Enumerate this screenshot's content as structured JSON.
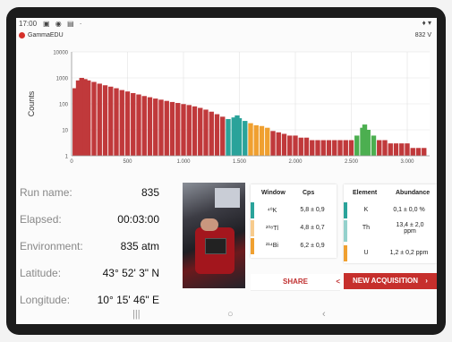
{
  "status_bar": {
    "time": "17:00",
    "icons": "▣ ◉ ▤ ·",
    "right": "♦ ▾"
  },
  "app_bar": {
    "name": "GammaEDU",
    "battery": "832 V"
  },
  "colors": {
    "accent": "#c62f2c",
    "k_band": "#2aa39a",
    "th_band": "#f0a030",
    "u_band": "#4caf50",
    "counts": "#c0393b"
  },
  "chart_data": {
    "type": "bar",
    "ylabel": "Counts",
    "xlabel": "",
    "y_scale": "log",
    "ylim": [
      1,
      10000
    ],
    "y_ticks": [
      "10000",
      "1000",
      "100",
      "10",
      "1"
    ],
    "x_ticks": [
      "0",
      "500",
      "1.000",
      "1.500",
      "2.000",
      "2.500",
      "3.000"
    ],
    "xlim": [
      0,
      3200
    ],
    "highlight_bands": [
      {
        "name": "K",
        "from": 1370,
        "to": 1570,
        "color": "#2aa39a"
      },
      {
        "name": "Th",
        "from": 1580,
        "to": 1750,
        "color": "#f0a030"
      },
      {
        "name": "U",
        "from": 2540,
        "to": 2720,
        "color": "#4caf50"
      }
    ],
    "spectrum": [
      [
        30,
        400
      ],
      [
        60,
        800
      ],
      [
        90,
        1000
      ],
      [
        120,
        900
      ],
      [
        150,
        800
      ],
      [
        200,
        700
      ],
      [
        250,
        600
      ],
      [
        300,
        520
      ],
      [
        350,
        460
      ],
      [
        400,
        400
      ],
      [
        450,
        340
      ],
      [
        500,
        300
      ],
      [
        550,
        260
      ],
      [
        600,
        230
      ],
      [
        650,
        200
      ],
      [
        700,
        180
      ],
      [
        750,
        160
      ],
      [
        800,
        145
      ],
      [
        850,
        130
      ],
      [
        900,
        118
      ],
      [
        950,
        108
      ],
      [
        1000,
        98
      ],
      [
        1050,
        90
      ],
      [
        1100,
        80
      ],
      [
        1150,
        70
      ],
      [
        1200,
        60
      ],
      [
        1250,
        50
      ],
      [
        1300,
        40
      ],
      [
        1350,
        32
      ],
      [
        1400,
        26
      ],
      [
        1450,
        30
      ],
      [
        1480,
        36
      ],
      [
        1500,
        28
      ],
      [
        1550,
        22
      ],
      [
        1600,
        18
      ],
      [
        1650,
        15
      ],
      [
        1700,
        14
      ],
      [
        1750,
        12
      ],
      [
        1800,
        9
      ],
      [
        1850,
        8
      ],
      [
        1900,
        7
      ],
      [
        1950,
        6
      ],
      [
        2000,
        6
      ],
      [
        2050,
        5
      ],
      [
        2100,
        5
      ],
      [
        2150,
        4
      ],
      [
        2200,
        4
      ],
      [
        2250,
        4
      ],
      [
        2300,
        4
      ],
      [
        2350,
        4
      ],
      [
        2400,
        4
      ],
      [
        2450,
        4
      ],
      [
        2500,
        4
      ],
      [
        2550,
        6
      ],
      [
        2600,
        12
      ],
      [
        2620,
        16
      ],
      [
        2650,
        10
      ],
      [
        2700,
        6
      ],
      [
        2750,
        4
      ],
      [
        2800,
        4
      ],
      [
        2850,
        3
      ],
      [
        2900,
        3
      ],
      [
        2950,
        3
      ],
      [
        3000,
        3
      ],
      [
        3050,
        2
      ],
      [
        3100,
        2
      ],
      [
        3150,
        2
      ]
    ]
  },
  "run": {
    "run_name_label": "Run name:",
    "run_name": "835",
    "elapsed_label": "Elapsed:",
    "elapsed": "00:03:00",
    "environment_label": "Environment:",
    "environment": "835 atm",
    "latitude_label": "Latitude:",
    "latitude": "43° 52' 3\" N",
    "longitude_label": "Longitude:",
    "longitude": "10° 15' 46\" E"
  },
  "window_table": {
    "headers": [
      "Window",
      "Cps"
    ],
    "rows": [
      {
        "window": "⁴⁰K",
        "cps": "5,8 ± 0,9"
      },
      {
        "window": "²⁰⁸Tl",
        "cps": "4,8 ± 0,7"
      },
      {
        "window": "²¹⁴Bi",
        "cps": "6,2 ± 0,9"
      }
    ]
  },
  "element_table": {
    "headers": [
      "Element",
      "Abundance"
    ],
    "rows": [
      {
        "element": "K",
        "abundance": "0,1 ± 0,0 %"
      },
      {
        "element": "Th",
        "abundance": "13,4 ± 2,0 ppm"
      },
      {
        "element": "U",
        "abundance": "1,2 ± 0,2 ppm"
      }
    ]
  },
  "actions": {
    "share": "SHARE",
    "share_arrow": "<",
    "new_acquisition": "NEW ACQUISITION",
    "new_arrow": "›"
  },
  "nav": {
    "recents": "|||",
    "home": "○",
    "back": "‹"
  }
}
